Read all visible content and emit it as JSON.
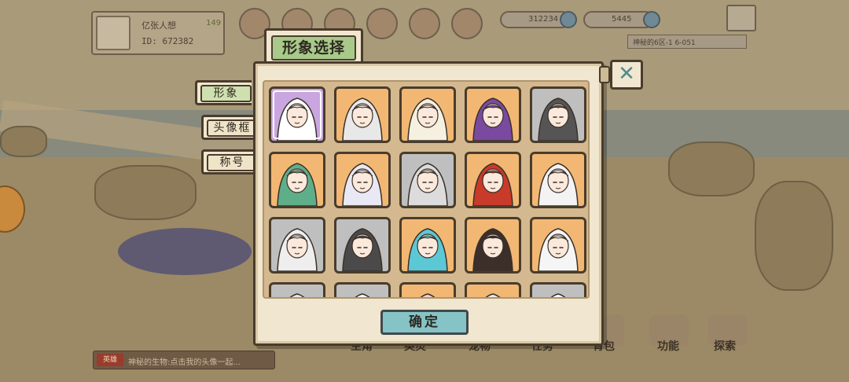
{
  "top": {
    "player_name": "亿张人想",
    "player_level": "149",
    "player_id": "ID: 672382",
    "currency_1": "312234",
    "currency_2": "5445",
    "server_info": "神秘的6区-1   6-051"
  },
  "dialog": {
    "title": "形象选择",
    "close_symbol": "✕",
    "tabs": [
      {
        "label": "形象",
        "active": true
      },
      {
        "label": "头像框",
        "active": false
      },
      {
        "label": "称号",
        "active": false
      }
    ],
    "confirm_label": "确定",
    "portraits": [
      {
        "name": "butterfly-witch-portrait",
        "frame": "purple",
        "selected": true
      },
      {
        "name": "white-hair-red-eyes-portrait",
        "frame": "orange"
      },
      {
        "name": "horned-sun-lady-portrait",
        "frame": "orange"
      },
      {
        "name": "purple-hair-queen-portrait",
        "frame": "orange"
      },
      {
        "name": "black-hair-girl-portrait",
        "frame": "gray"
      },
      {
        "name": "antler-green-girl-portrait",
        "frame": "orange"
      },
      {
        "name": "masked-demon-portrait",
        "frame": "orange"
      },
      {
        "name": "horned-silver-lady-portrait",
        "frame": "gray"
      },
      {
        "name": "red-lion-warrior-portrait",
        "frame": "orange"
      },
      {
        "name": "bunny-masked-girl-portrait",
        "frame": "orange"
      },
      {
        "name": "hooded-girl-portrait",
        "frame": "gray"
      },
      {
        "name": "gas-mask-kid-portrait",
        "frame": "gray"
      },
      {
        "name": "cyan-bunny-girl-portrait",
        "frame": "orange"
      },
      {
        "name": "dark-masked-sage-portrait",
        "frame": "orange"
      },
      {
        "name": "purple-flame-warrior-portrait",
        "frame": "orange"
      },
      {
        "name": "row4-portrait-1",
        "frame": "gray"
      },
      {
        "name": "row4-portrait-2",
        "frame": "gray"
      },
      {
        "name": "row4-portrait-3",
        "frame": "orange"
      },
      {
        "name": "row4-portrait-4",
        "frame": "orange"
      },
      {
        "name": "row4-portrait-5",
        "frame": "gray"
      }
    ]
  },
  "bottom_nav": [
    "主角",
    "英灵",
    "宠物",
    "任务",
    "背包",
    "功能",
    "探索"
  ],
  "ticker": {
    "tag": "英雄",
    "text": "神秘的生物:点击我的头像一起..."
  },
  "colors": {
    "panel": "#f1e6cf",
    "title_green": "#a8c98a",
    "confirm_teal": "#86c3c6",
    "frame_orange": "#f2b873",
    "frame_gray": "#bfbfbf"
  }
}
